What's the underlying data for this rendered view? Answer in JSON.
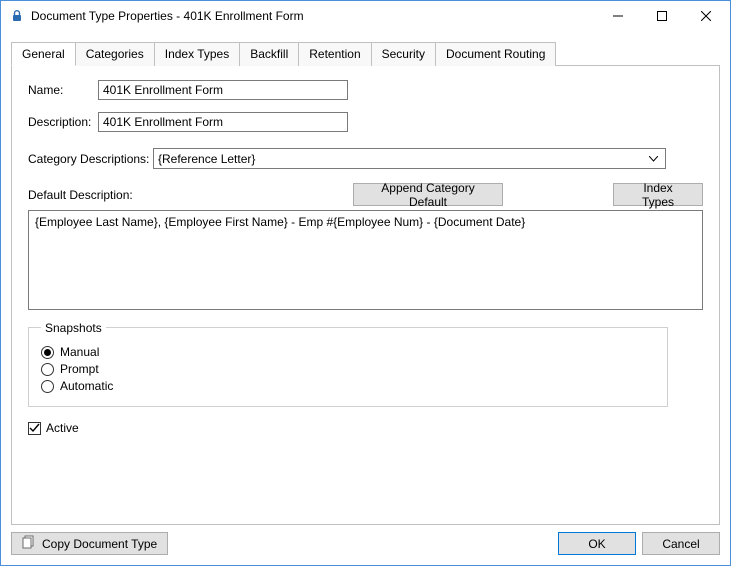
{
  "window": {
    "title": "Document Type Properties  - 401K Enrollment Form"
  },
  "tabs": {
    "items": [
      {
        "label": "General"
      },
      {
        "label": "Categories"
      },
      {
        "label": "Index Types"
      },
      {
        "label": "Backfill"
      },
      {
        "label": "Retention"
      },
      {
        "label": "Security"
      },
      {
        "label": "Document Routing"
      }
    ],
    "active": 0
  },
  "general": {
    "name_label": "Name:",
    "name_value": "401K Enrollment Form",
    "description_label": "Description:",
    "description_value": "401K Enrollment Form",
    "category_desc_label": "Category Descriptions:",
    "category_desc_value": "{Reference Letter}",
    "default_desc_label": "Default Description:",
    "append_btn": "Append Category Default",
    "index_types_btn": "Index Types",
    "default_desc_value": "{Employee Last Name}, {Employee First Name} - Emp #{Employee Num} - {Document Date}",
    "snapshots": {
      "legend": "Snapshots",
      "options": [
        {
          "label": "Manual",
          "checked": true
        },
        {
          "label": "Prompt",
          "checked": false
        },
        {
          "label": "Automatic",
          "checked": false
        }
      ]
    },
    "active_label": "Active",
    "active_checked": true
  },
  "footer": {
    "copy_btn": "Copy Document Type",
    "ok_btn": "OK",
    "cancel_btn": "Cancel"
  }
}
